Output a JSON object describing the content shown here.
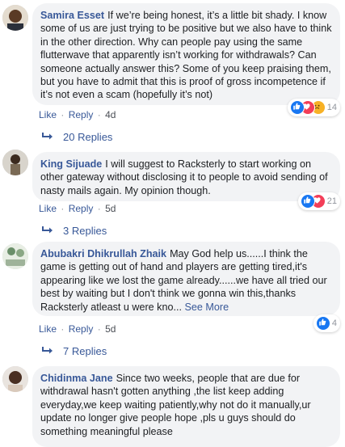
{
  "comments": [
    {
      "author": "Samira Esset",
      "text": "If we’re being honest, it’s a little bit shady. I know some of us are just trying to be positive but we also have to think in the other direction. Why can people pay using the same flutterwave that apparently isn’t working for withdrawals? Can someone actually answer this? Some of you keep praising them, but you have to admit that this is proof of gross incompetence if it’s not even a scam (hopefully it’s not)",
      "see_more": "",
      "actions": {
        "like": "Like",
        "reply": "Reply",
        "sep": "·",
        "time": "4d"
      },
      "reactions": {
        "icons": [
          "like-icon",
          "love-icon",
          "sad-icon"
        ],
        "count": "14"
      },
      "replies_label": "20 Replies"
    },
    {
      "author": "King Sijuade",
      "text": "I will suggest to Racksterly to start working on other gateway without disclosing it to people to avoid sending of nasty mails again. My opinion though.",
      "see_more": "",
      "actions": {
        "like": "Like",
        "reply": "Reply",
        "sep": "·",
        "time": "5d"
      },
      "reactions": {
        "icons": [
          "like-icon",
          "love-icon"
        ],
        "count": "21"
      },
      "replies_label": "3 Replies"
    },
    {
      "author": "Abubakri Dhikrullah Zhaik",
      "text": "May God help us......I think the game is getting out of hand and players are getting tired,it's appearing like we lost the game already......we have all tried our best by waiting but I don't think we gonna win this,thanks Racksterly atleast u were kno...",
      "see_more": "See More",
      "actions": {
        "like": "Like",
        "reply": "Reply",
        "sep": "·",
        "time": "5d"
      },
      "reactions": {
        "icons": [
          "like-icon"
        ],
        "count": "4"
      },
      "replies_label": "7 Replies"
    },
    {
      "author": "Chidinma Jane",
      "text": "Since two weeks, people that are due for withdrawal hasn't gotten anything ,the list keep adding everyday,we keep waiting patiently,why not do it manually,ur update no longer give people hope ,pls u guys should do something meaningful please",
      "see_more": ""
    }
  ],
  "colors": {
    "link": "#385898",
    "bubble": "#f2f3f5",
    "like": "#1877f2",
    "love": "#f33e58",
    "sad": "#f7b125"
  }
}
